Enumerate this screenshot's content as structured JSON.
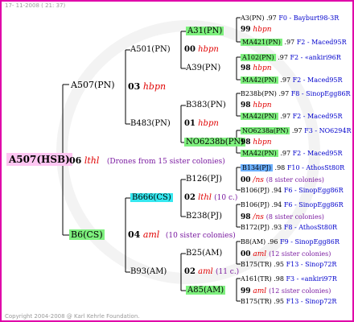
{
  "stamp": "17- 11-2008 ( 21: 37)",
  "copyright": "Copyright 2004-2008 @ Karl Kehrle Foundation.",
  "root": {
    "label": "A507(HSB)",
    "gen": "06",
    "breeder": "lthl",
    "note": "(Drones from 15 sister colonies)"
  },
  "queen": {
    "label": "A507(PN)",
    "gen": "03",
    "breeder": "hbpn"
  },
  "drone_line": {
    "label": "B6(CS)",
    "gen": "04",
    "breeder": "aml",
    "note": "(10 sister colonies)"
  },
  "qq": {
    "a501": {
      "label": "A501(PN)",
      "gen": "00",
      "breeder": "hbpn"
    },
    "b483": {
      "label": "B483(PN)",
      "gen": "01",
      "breeder": "hbpn"
    },
    "b666": {
      "label": "B666(CS)",
      "gen": "02",
      "breeder": "lthl",
      "note": "(10 c.)"
    },
    "b93": {
      "label": "B93(AM)",
      "gen": "02",
      "breeder": "aml",
      "note": "(11 c.)"
    }
  },
  "level3": {
    "a31": "A31(PN)",
    "a39": "A39(PN)",
    "b383": "B383(PN)",
    "no6238b": "NO6238b(PN)",
    "b126": "B126(PJ)",
    "b238": "B238(PJ)",
    "b25": "B25(AM)",
    "a85": "A85(AM)",
    "g_a31": "99",
    "b_a31": "hbpn",
    "g_a39": "98",
    "b_a39": "hbpn",
    "g_b383": "98",
    "b_b383": "hbpn",
    "g_no": "98",
    "b_no": "hbpn",
    "g_b126": "00",
    "b_b126": "/ns",
    "n_b126": "(8 sister colonies)",
    "g_b238": "98",
    "b_b238": "/ns",
    "n_b238": "(8 sister colonies)",
    "g_b25": "00",
    "b_b25": "aml",
    "n_b25": "(12 sister colonies)",
    "g_a85": "99",
    "b_a85": "aml",
    "n_a85": "(12 sister colonies)"
  },
  "leaves": [
    {
      "name": "A3(PN)",
      "val": ".97",
      "src": "F0 - Bayburt98-3R"
    },
    {
      "name": "MA421(PN)",
      "val": ".97",
      "src": "F2 - Maced95R"
    },
    {
      "name": "A102(PN)",
      "val": ".97",
      "src": "F2 - «ankiri96R"
    },
    {
      "name": "MA42(PN)",
      "val": ".97",
      "src": "F2 - Maced95R"
    },
    {
      "name": "B238b(PN)",
      "val": ".97",
      "src": "F8 - SinopEgg86R"
    },
    {
      "name": "MA42(PN)",
      "val": ".97",
      "src": "F2 - Maced95R"
    },
    {
      "name": "NO6238a(PN)",
      "val": ".97",
      "src": "F3 - NO6294R"
    },
    {
      "name": "MA42(PN)",
      "val": ".97",
      "src": "F2 - Maced95R"
    },
    {
      "name": "B134(PJ)",
      "val": ".98",
      "src": "F10 - AthosSt80R"
    },
    {
      "name": "B106(PJ)",
      "val": ".94",
      "src": "F6 - SinopEgg86R"
    },
    {
      "name": "B106(PJ)",
      "val": ".94",
      "src": "F6 - SinopEgg86R"
    },
    {
      "name": "B172(PJ)",
      "val": ".93",
      "src": "F8 - AthosSt80R"
    },
    {
      "name": "B8(AM)",
      "val": ".96",
      "src": "F9 - SinopEgg86R"
    },
    {
      "name": "B175(TR)",
      "val": ".95",
      "src": "F13 - Sinop72R"
    },
    {
      "name": "A161(TR)",
      "val": ".98",
      "src": "F3 - «ankiri97R"
    },
    {
      "name": "B175(TR)",
      "val": ".95",
      "src": "F13 - Sinop72R"
    }
  ]
}
